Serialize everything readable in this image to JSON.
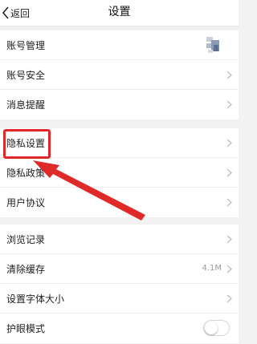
{
  "header": {
    "back_label": "返回",
    "title": "设置"
  },
  "groups": [
    {
      "rows": [
        {
          "label": "账号管理",
          "trailing": "avatar"
        },
        {
          "label": "账号安全",
          "trailing": "chevron"
        },
        {
          "label": "消息提醒",
          "trailing": "chevron"
        }
      ]
    },
    {
      "rows": [
        {
          "label": "隐私设置",
          "trailing": "chevron"
        },
        {
          "label": "隐私政策",
          "trailing": "chevron"
        },
        {
          "label": "用户协议",
          "trailing": "chevron"
        }
      ]
    },
    {
      "rows": [
        {
          "label": "浏览记录",
          "trailing": "chevron"
        },
        {
          "label": "清除缓存",
          "trailing": "value",
          "value": "4.1M"
        },
        {
          "label": "设置字体大小",
          "trailing": "chevron"
        },
        {
          "label": "护眼模式",
          "trailing": "toggle",
          "toggle_on": false
        }
      ]
    }
  ],
  "annotation": {
    "color": "#e02a2a",
    "target": "隐私设置"
  },
  "icons": {
    "back": "chevron-left-icon",
    "row": "chevron-right-icon"
  },
  "colors": {
    "background": "#f2f2f2",
    "row_background": "#ffffff",
    "text": "#222222",
    "secondary_text": "#999999"
  }
}
